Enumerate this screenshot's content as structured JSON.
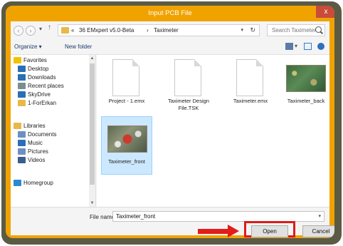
{
  "window": {
    "title": "Input PCB File",
    "close_glyph": "x"
  },
  "address": {
    "overflow": "«",
    "path_root": "36 EMxpert v5.0-Beta",
    "separator": "›",
    "current": "Taximeter",
    "search_placeholder": "Search Taximeter"
  },
  "toolbar": {
    "organize": "Organize ▾",
    "new_folder": "New folder"
  },
  "sidebar": {
    "items": [
      {
        "label": "Favorites",
        "icon": "star-icon",
        "color": "#f2c200"
      },
      {
        "label": "Desktop",
        "icon": "desktop-icon",
        "color": "#2a6fb5"
      },
      {
        "label": "Downloads",
        "icon": "downloads-icon",
        "color": "#2a6fb5"
      },
      {
        "label": "Recent places",
        "icon": "recent-places-icon",
        "color": "#7f8c8d"
      },
      {
        "label": "SkyDrive",
        "icon": "skydrive-icon",
        "color": "#2a6fb5"
      },
      {
        "label": "1-ForErkan",
        "icon": "folder-icon",
        "color": "#e8b84a"
      },
      {
        "label": "Libraries",
        "icon": "libraries-icon",
        "color": "#e8b84a"
      },
      {
        "label": "Documents",
        "icon": "documents-icon",
        "color": "#6e8fbf"
      },
      {
        "label": "Music",
        "icon": "music-icon",
        "color": "#2a6fb5"
      },
      {
        "label": "Pictures",
        "icon": "pictures-icon",
        "color": "#6e8fbf"
      },
      {
        "label": "Videos",
        "icon": "videos-icon",
        "color": "#3b5d89"
      },
      {
        "label": "Homegroup",
        "icon": "homegroup-icon",
        "color": "#2a8ad0"
      }
    ]
  },
  "files": [
    {
      "label": "Project - 1.emx",
      "type": "document"
    },
    {
      "label": "Taximeter Design File.TSK",
      "type": "document"
    },
    {
      "label": "Taximeter.emx",
      "type": "document"
    },
    {
      "label": "Taximeter_back",
      "type": "image"
    },
    {
      "label": "Taximeter_front",
      "type": "image",
      "selected": true
    }
  ],
  "bottom": {
    "filename_label": "File name:",
    "filename_value": "Taximeter_front",
    "open_label": "Open",
    "cancel_label": "Cancel"
  },
  "colors": {
    "title_bar": "#f0a300",
    "highlight": "#e01b1b",
    "selection": "#cce8ff"
  }
}
